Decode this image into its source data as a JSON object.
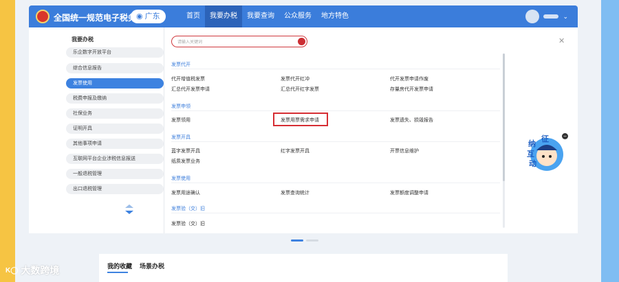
{
  "header": {
    "brand": "全国统一规范电子税务局",
    "region": "广东",
    "nav": [
      "首页",
      "我要办税",
      "我要查询",
      "公众服务",
      "地方特色"
    ],
    "active_nav": 1,
    "user_chevron": "⌄"
  },
  "sidebar": {
    "title": "我要办税",
    "items": [
      {
        "label": "乐企数字开放平台"
      },
      {
        "label": "综合信息报告"
      },
      {
        "label": "发票使用"
      },
      {
        "label": "税费申报及缴纳"
      },
      {
        "label": "社保业务"
      },
      {
        "label": "证明开具"
      },
      {
        "label": "其他事项申请"
      },
      {
        "label": "互联网平台企业涉税信息报送"
      },
      {
        "label": "一般退税管理"
      },
      {
        "label": "出口退税管理"
      }
    ],
    "active_index": 2
  },
  "search": {
    "placeholder": "请输入关键词"
  },
  "close_label": "✕",
  "sections": [
    {
      "title": "发票代开",
      "links": [
        "代开增值税发票",
        "发票代开红冲",
        "代开发票申请作废",
        "汇总代开发票申请",
        "汇总代开红字发票",
        "存量房代开发票申请"
      ]
    },
    {
      "title": "发票申领",
      "links": [
        "发票领用",
        "发票用票需求申请",
        "发票遗失、损毁报告"
      ]
    },
    {
      "title": "发票开具",
      "links": [
        "蓝字发票开具",
        "红字发票开具",
        "开票信息维护",
        "纸质发票业务"
      ]
    },
    {
      "title": "发票使用",
      "links": [
        "发票用途确认",
        "发票查询统计",
        "发票额度调整申请"
      ]
    },
    {
      "title": "发票验（交）旧",
      "links": [
        "发票验（交）旧"
      ]
    }
  ],
  "bottom_tabs": [
    "我的收藏",
    "场景办税"
  ],
  "mascot": {
    "chars": [
      "征",
      "纳",
      "互",
      "动"
    ],
    "close": "−"
  },
  "watermark": {
    "logo": "K◯",
    "text": "大数跨境"
  },
  "colors": {
    "primary": "#3b7ddb",
    "highlight": "#d62d33",
    "accent_red": "#cc2f34"
  }
}
